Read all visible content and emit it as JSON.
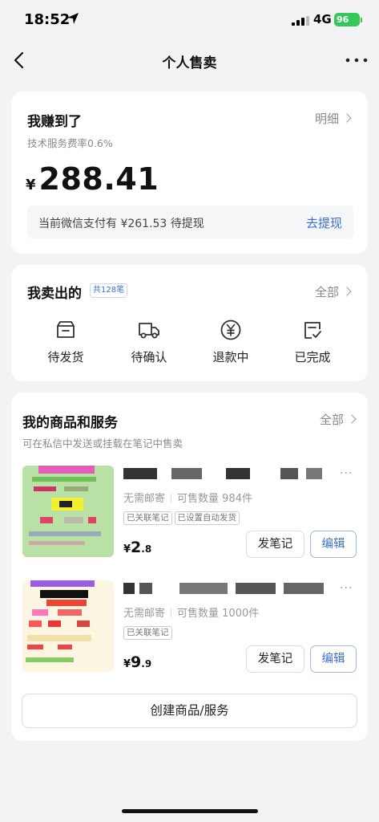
{
  "status": {
    "time": "18:52",
    "network": "4G",
    "battery": "96"
  },
  "nav": {
    "title": "个人售卖"
  },
  "earnings": {
    "title": "我赚到了",
    "rate": "技术服务费率0.6%",
    "detail_label": "明细",
    "currency": "¥",
    "amount": "288.41",
    "pending_text": "当前微信支付有 ¥261.53 待提现",
    "withdraw_label": "去提现"
  },
  "sold": {
    "title": "我卖出的",
    "count": "共128笔",
    "all_label": "全部",
    "items": [
      {
        "label": "待发货",
        "icon": "box-icon"
      },
      {
        "label": "待确认",
        "icon": "truck-icon"
      },
      {
        "label": "退款中",
        "icon": "yen-circle-icon"
      },
      {
        "label": "已完成",
        "icon": "check-doc-icon"
      }
    ]
  },
  "products": {
    "title": "我的商品和服务",
    "subtitle": "可在私信中发送或挂载在笔记中售卖",
    "all_label": "全部",
    "items": [
      {
        "shipping": "无需邮寄",
        "stock": "可售数量 984件",
        "tags": [
          "已关联笔记",
          "已设置自动发货"
        ],
        "currency": "¥",
        "price_int": "2",
        "price_dec": ".8",
        "note_btn": "发笔记",
        "edit_btn": "编辑"
      },
      {
        "shipping": "无需邮寄",
        "stock": "可售数量 1000件",
        "tags": [
          "已关联笔记"
        ],
        "currency": "¥",
        "price_int": "9",
        "price_dec": ".9",
        "note_btn": "发笔记",
        "edit_btn": "编辑"
      }
    ],
    "create_label": "创建商品/服务"
  }
}
